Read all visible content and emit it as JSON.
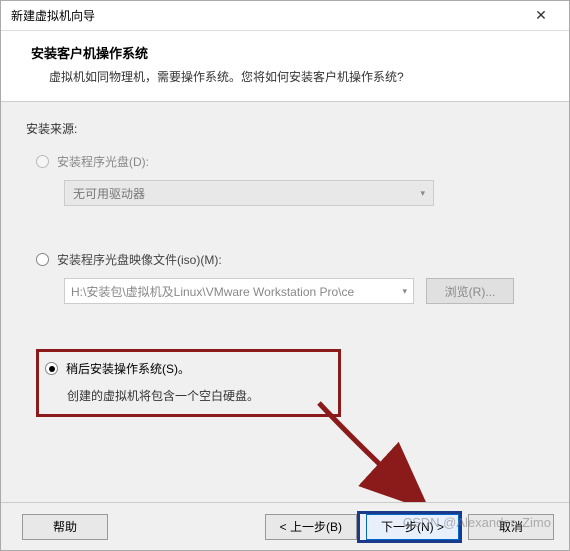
{
  "titlebar": {
    "title": "新建虚拟机向导",
    "close_glyph": "✕"
  },
  "header": {
    "heading": "安装客户机操作系统",
    "subheading": "虚拟机如同物理机，需要操作系统。您将如何安装客户机操作系统?"
  },
  "content": {
    "source_label": "安装来源:",
    "opt_disc": {
      "label": "安装程序光盘(D):",
      "dropdown_text": "无可用驱动器"
    },
    "opt_iso": {
      "label": "安装程序光盘映像文件(iso)(M):",
      "path_text": "H:\\安装包\\虚拟机及Linux\\VMware Workstation Pro\\ce",
      "browse_label": "浏览(R)..."
    },
    "opt_later": {
      "label": "稍后安装操作系统(S)。",
      "desc": "创建的虚拟机将包含一个空白硬盘。"
    }
  },
  "footer": {
    "help": "帮助",
    "back": "< 上一步(B)",
    "next": "下一步(N) >",
    "cancel": "取消"
  },
  "watermark": "CSDN @Alexander_Zimo",
  "colors": {
    "highlight_red": "#8b1a1a",
    "highlight_blue": "#1a3a8b"
  }
}
